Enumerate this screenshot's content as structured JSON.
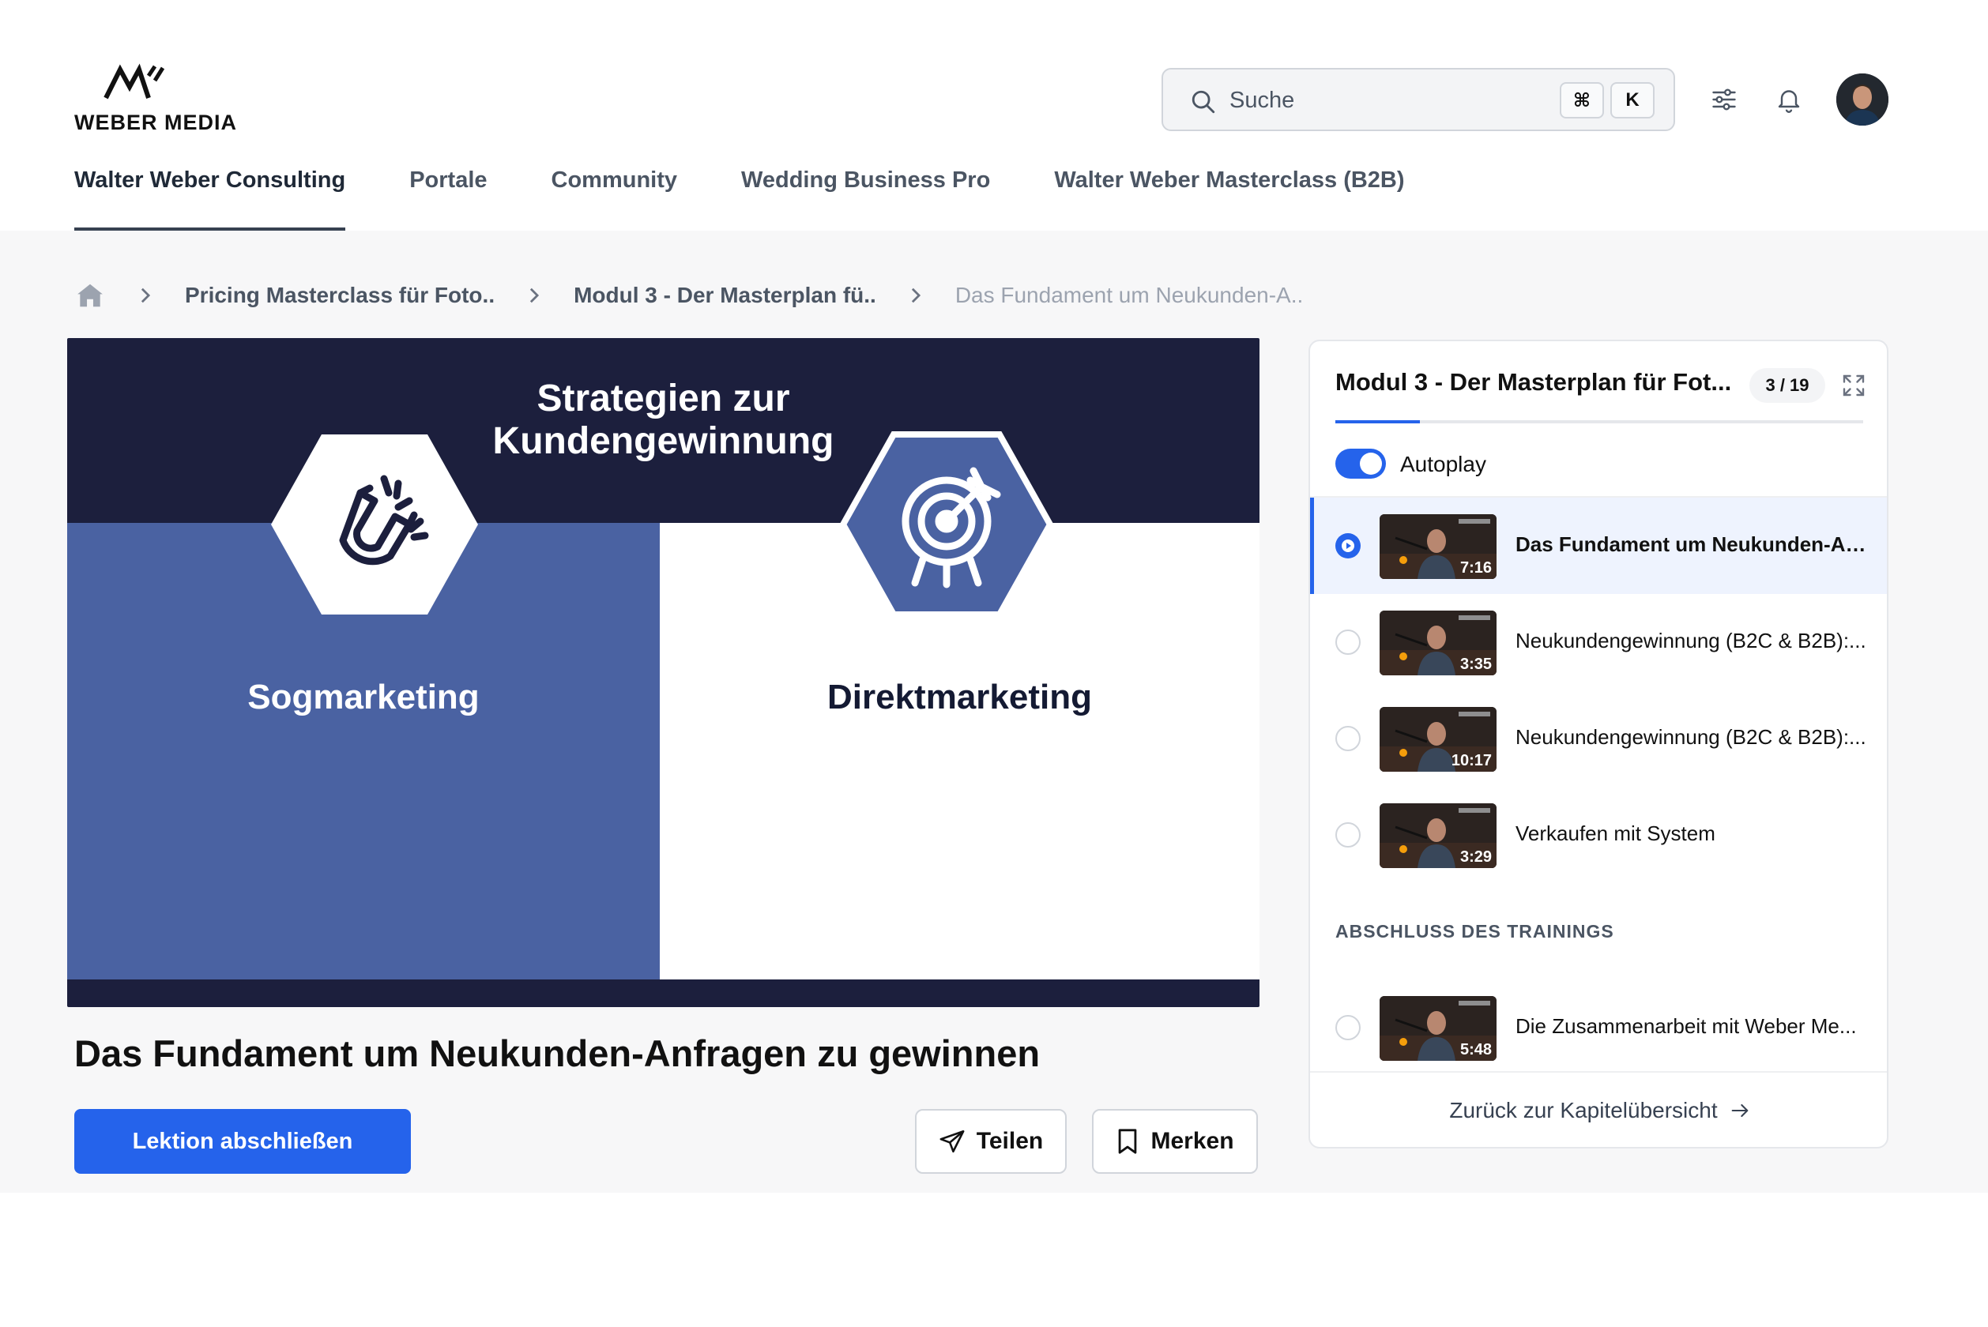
{
  "brand": {
    "name": "WEBER MEDIA"
  },
  "search": {
    "placeholder": "Suche",
    "shortcut_cmd": "⌘",
    "shortcut_key": "K"
  },
  "nav": {
    "tabs": [
      {
        "label": "Walter Weber Consulting",
        "active": true
      },
      {
        "label": "Portale",
        "active": false
      },
      {
        "label": "Community",
        "active": false
      },
      {
        "label": "Wedding Business Pro",
        "active": false
      },
      {
        "label": "Walter Weber Masterclass (B2B)",
        "active": false
      }
    ]
  },
  "breadcrumb": {
    "items": [
      "Pricing Masterclass für Foto..",
      "Modul 3 - Der Masterplan fü..",
      "Das Fundament um Neukunden-A.."
    ]
  },
  "video": {
    "title_line1": "Strategien zur",
    "title_line2": "Kundengewinnung",
    "left_label": "Sogmarketing",
    "right_label": "Direktmarketing",
    "colors": {
      "navy": "#1c1f3d",
      "blue": "#4a62a2"
    }
  },
  "lesson": {
    "title": "Das Fundament um Neukunden-Anfragen zu gewinnen",
    "complete_label": "Lektion abschließen",
    "share_label": "Teilen",
    "save_label": "Merken"
  },
  "sidebar": {
    "title": "Modul 3 - Der Masterplan für Fot...",
    "count": "3 / 19",
    "progress": 0.16,
    "autoplay_label": "Autoplay",
    "autoplay_on": true,
    "lessons": [
      {
        "title": "Das Fundament um Neukunden-Anf...",
        "duration": "7:16",
        "active": true
      },
      {
        "title": "Neukundengewinnung (B2C & B2B):...",
        "duration": "3:35",
        "active": false
      },
      {
        "title": "Neukundengewinnung (B2C & B2B):...",
        "duration": "10:17",
        "active": false
      },
      {
        "title": "Verkaufen mit System",
        "duration": "3:29",
        "active": false
      }
    ],
    "section_label": "ABSCHLUSS DES TRAININGS",
    "final_lessons": [
      {
        "title": "Die Zusammenarbeit mit Weber Me...",
        "duration": "5:48",
        "active": false
      }
    ],
    "back_label": "Zurück zur Kapitelübersicht"
  },
  "accent_color": "#2563eb"
}
